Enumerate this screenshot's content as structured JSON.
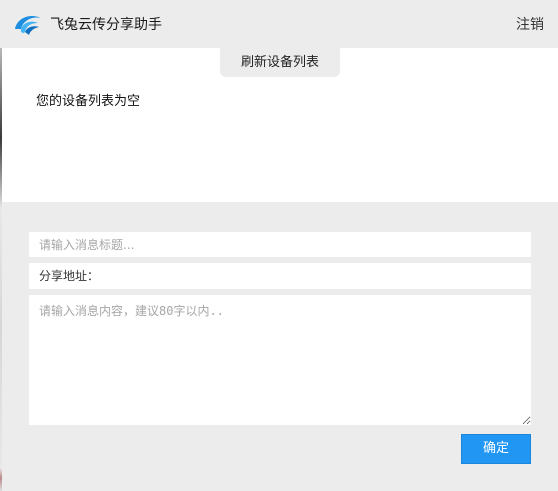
{
  "header": {
    "app_title": "飞兔云传分享助手",
    "logout_label": "注销",
    "logo_icon": "rabbit-swoosh-logo-icon",
    "accent_color": "#2196f3"
  },
  "device_list": {
    "refresh_label": "刷新设备列表",
    "empty_message": "您的设备列表为空"
  },
  "form": {
    "title_placeholder": "请输入消息标题...",
    "title_value": "",
    "share_address_label": "分享地址：",
    "content_placeholder": "请输入消息内容，建议80字以内..",
    "content_value": "",
    "confirm_label": "确定",
    "confirm_color": "#2196f3"
  }
}
